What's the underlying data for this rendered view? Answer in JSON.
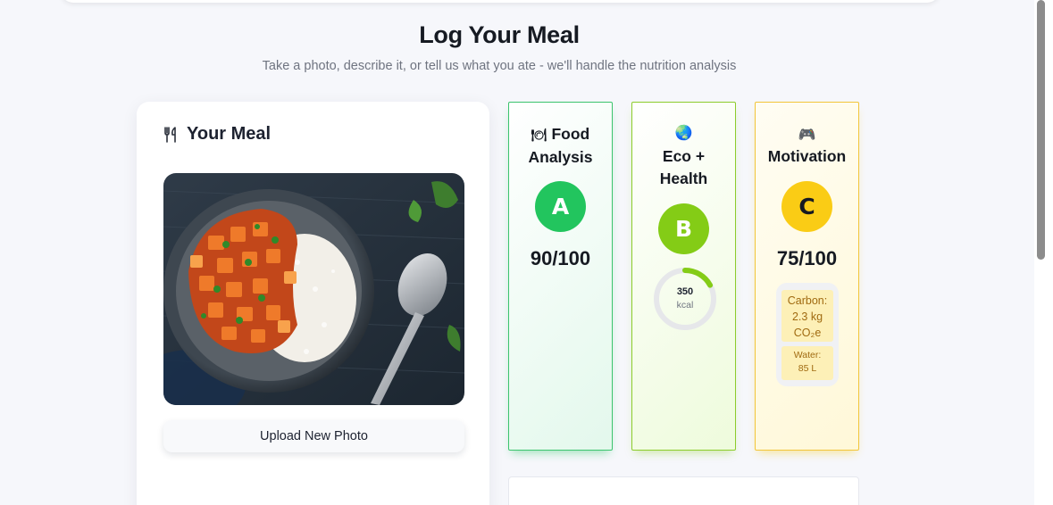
{
  "header": {
    "title": "Log Your Meal",
    "subtitle": "Take a photo, describe it, or tell us what you ate - we'll handle the nutrition analysis"
  },
  "meal_card": {
    "title": "Your Meal",
    "icon": "fork-knife-icon",
    "photo": "meal-photo-tofu-curry-rice-bowl",
    "upload_label": "Upload New Photo"
  },
  "score_cards": {
    "food": {
      "emoji": "🍽",
      "title_line1": "Food",
      "title_line2": "Analysis",
      "grade": "A",
      "score": "90/100",
      "accent": "#22c55e"
    },
    "eco": {
      "emoji": "🌏",
      "title_line1": "Eco +",
      "title_line2": "Health",
      "grade": "B",
      "kcal_value": "350",
      "kcal_unit": "kcal",
      "kcal_progress": 0.17,
      "accent": "#84cc16"
    },
    "motivation": {
      "emoji": "🎮",
      "title": "Motivation",
      "grade": "C",
      "score": "75/100",
      "carbon_label": "Carbon:",
      "carbon_value": "2.3 kg",
      "carbon_unit": "CO₂e",
      "water_label": "Water:",
      "water_value": "85 L",
      "accent": "#facc15"
    }
  }
}
